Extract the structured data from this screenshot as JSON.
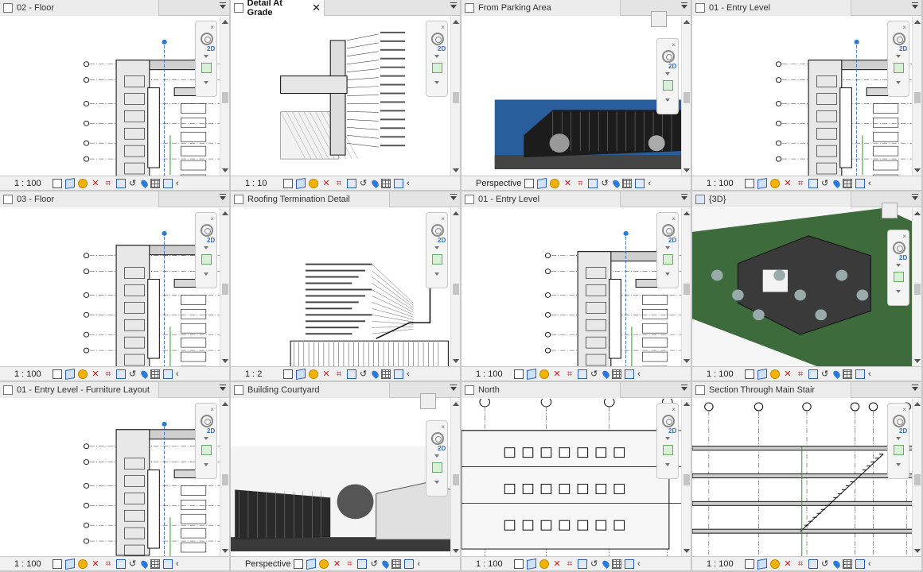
{
  "views": [
    {
      "title": "02 - Floor",
      "scale": "1 : 100",
      "type": "plan",
      "active": false
    },
    {
      "title": "Detail At Grade",
      "scale": "1 : 10",
      "type": "detail",
      "active": true
    },
    {
      "title": "From Parking Area",
      "scale": "Perspective",
      "type": "render",
      "active": false
    },
    {
      "title": "01 - Entry Level",
      "scale": "1 : 100",
      "type": "plan",
      "active": false
    },
    {
      "title": "03 - Floor",
      "scale": "1 : 100",
      "type": "plan",
      "active": false
    },
    {
      "title": "Roofing Termination Detail",
      "scale": "1 : 2",
      "type": "detail",
      "active": false
    },
    {
      "title": "01 - Entry Level",
      "scale": "1 : 100",
      "type": "plan",
      "active": false
    },
    {
      "title": "{3D}",
      "scale": "1 : 100",
      "type": "3d",
      "active": false
    },
    {
      "title": "01 - Entry Level - Furniture Layout",
      "scale": "1 : 100",
      "type": "plan",
      "active": false
    },
    {
      "title": "Building Courtyard",
      "scale": "Perspective",
      "type": "render",
      "active": false
    },
    {
      "title": "North",
      "scale": "1 : 100",
      "type": "elevation",
      "active": false
    },
    {
      "title": "Section Through Main Stair",
      "scale": "1 : 100",
      "type": "section",
      "active": false
    }
  ],
  "nav_label": "2D",
  "close_glyph": "✕",
  "colors": {
    "accent_blue": "#2b60b8",
    "grid_bg": "#d8d8d8",
    "green_line": "#2aa02a"
  }
}
